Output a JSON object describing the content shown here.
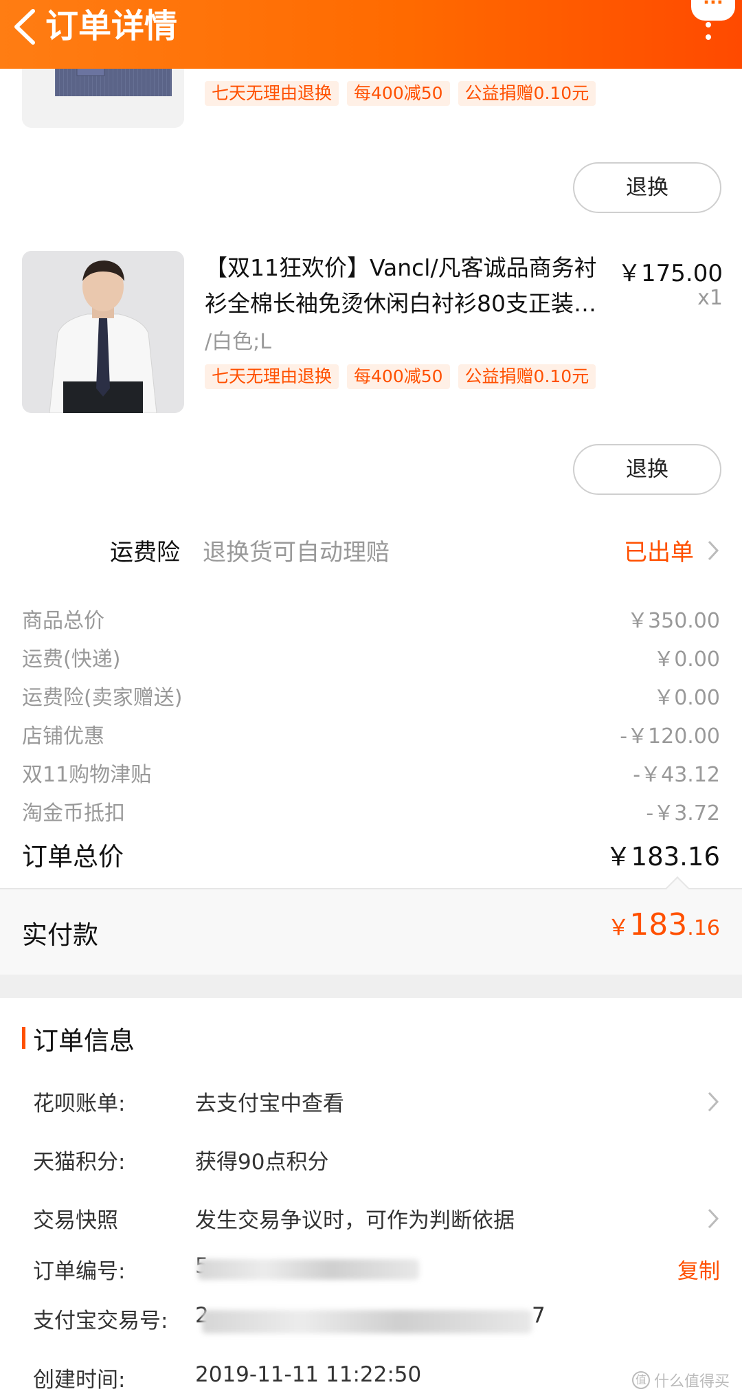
{
  "header": {
    "title": "订单详情",
    "more_dots": "···"
  },
  "products": [
    {
      "tags": [
        "七天无理由退换",
        "每400减50",
        "公益捐赠0.10元"
      ],
      "return_label": "退换"
    },
    {
      "title": "【双11狂欢价】Vancl/凡客诚品商务衬衫全棉长袖免烫休闲白衬衫80支正装…",
      "price": "￥175.00",
      "qty": "x1",
      "sku": "/白色;L",
      "tags": [
        "七天无理由退换",
        "每400减50",
        "公益捐赠0.10元"
      ],
      "return_label": "退换"
    }
  ],
  "insurance": {
    "label": "运费险",
    "desc": "退换货可自动理赔",
    "status": "已出单"
  },
  "summary": [
    {
      "label": "商品总价",
      "value": "￥350.00"
    },
    {
      "label": "运费(快递)",
      "value": "￥0.00"
    },
    {
      "label": "运费险(卖家赠送)",
      "value": "￥0.00"
    },
    {
      "label": "店铺优惠",
      "value": "-￥120.00"
    },
    {
      "label": "双11购物津贴",
      "value": "-￥43.12"
    },
    {
      "label": "淘金币抵扣",
      "value": "-￥3.72"
    }
  ],
  "total": {
    "label": "订单总价",
    "value": "￥183.16"
  },
  "paid": {
    "label": "实付款",
    "yen": "￥",
    "int": "183",
    "dec": ".16"
  },
  "order_info": {
    "title": "订单信息",
    "rows": [
      {
        "label": "花呗账单:",
        "value": "去支付宝中查看"
      },
      {
        "label": "天猫积分:",
        "value": "获得90点积分"
      },
      {
        "label": "交易快照",
        "value": "发生交易争议时，可作为判断依据"
      },
      {
        "label": "订单编号:",
        "value": "5",
        "action": "复制"
      },
      {
        "label": "支付宝交易号:",
        "value": "2",
        "value_tail": "7"
      },
      {
        "label": "创建时间:",
        "value": "2019-11-11 11:22:50"
      }
    ]
  },
  "watermark": "什么值得买",
  "colors": {
    "accent": "#ff5000",
    "header_gradient_start": "#ff7d13",
    "header_gradient_end": "#ff4a00"
  }
}
